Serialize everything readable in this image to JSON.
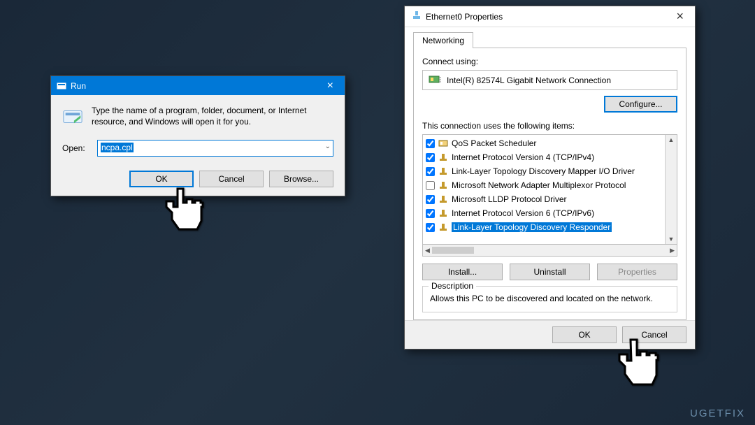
{
  "run": {
    "title": "Run",
    "hint": "Type the name of a program, folder, document, or Internet resource, and Windows will open it for you.",
    "open_label": "Open:",
    "input_value": "ncpa.cpl",
    "ok": "OK",
    "cancel": "Cancel",
    "browse": "Browse..."
  },
  "props": {
    "title": "Ethernet0 Properties",
    "tab": "Networking",
    "connect_using_label": "Connect using:",
    "adapter": "Intel(R) 82574L Gigabit Network Connection",
    "configure": "Configure...",
    "list_label": "This connection uses the following items:",
    "items": [
      {
        "checked": true,
        "icon": "module",
        "label": "QoS Packet Scheduler"
      },
      {
        "checked": true,
        "icon": "proto",
        "label": "Internet Protocol Version 4 (TCP/IPv4)"
      },
      {
        "checked": true,
        "icon": "proto",
        "label": "Link-Layer Topology Discovery Mapper I/O Driver"
      },
      {
        "checked": false,
        "icon": "proto",
        "label": "Microsoft Network Adapter Multiplexor Protocol"
      },
      {
        "checked": true,
        "icon": "proto",
        "label": "Microsoft LLDP Protocol Driver"
      },
      {
        "checked": true,
        "icon": "proto",
        "label": "Internet Protocol Version 6 (TCP/IPv6)"
      },
      {
        "checked": true,
        "icon": "proto",
        "label": "Link-Layer Topology Discovery Responder",
        "selected": true
      }
    ],
    "install": "Install...",
    "uninstall": "Uninstall",
    "properties": "Properties",
    "desc_legend": "Description",
    "desc_text": "Allows this PC to be discovered and located on the network.",
    "ok": "OK",
    "cancel": "Cancel"
  },
  "watermark": "UGETFIX"
}
